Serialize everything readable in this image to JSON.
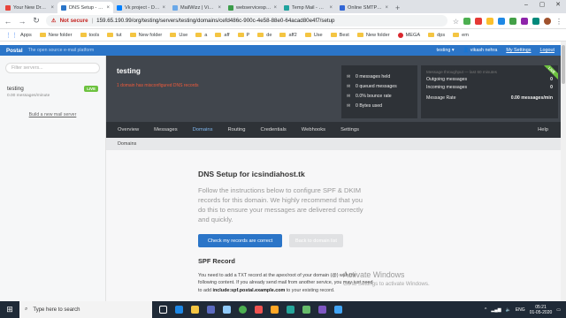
{
  "browser": {
    "tabs": [
      {
        "title": "Your New Droplet",
        "color": "#e8453c",
        "active": false
      },
      {
        "title": "DNS Setup - icsin",
        "color": "#2b75c8",
        "active": true
      },
      {
        "title": "Vk project - Digit",
        "color": "#0080ff",
        "active": false
      },
      {
        "title": "MailWizz | View d",
        "color": "#6aa8e8",
        "active": false
      },
      {
        "title": "webservicespot |",
        "color": "#3b9c4a",
        "active": false
      },
      {
        "title": "Temp Mail - Disp",
        "color": "#20a39e",
        "active": false
      },
      {
        "title": "Online SMTP tool",
        "color": "#3367d6",
        "active": false
      }
    ],
    "not_secure": "Not secure",
    "url": "159.65.190.99/org/testing/servers/testing/domains/cefd486c-900c-4e58-88e0-64acad80e4f7/setup",
    "bookmarks": [
      "Apps",
      "New folder",
      "tools",
      "tut",
      "New folder",
      "Use",
      "a",
      "aff",
      "P",
      "de",
      "aff2",
      "Use",
      "Best",
      "New folder",
      "MEGA",
      "dps",
      "em"
    ]
  },
  "postal": {
    "logo": "Postal",
    "tagline": "The open source e-mail platform",
    "org": "testing ▾",
    "user": "👤 vikash nehra",
    "settings": "My Settings",
    "logout": "Logout"
  },
  "sidebar": {
    "filter_placeholder": "Filter servers...",
    "server_name": "testing",
    "live_badge": "LIVE",
    "rate": "0.00 messages/minute",
    "build_link": "Build a new mail server"
  },
  "server": {
    "title": "testing",
    "warning": "1 domain has misconfigured DNS records",
    "stats": [
      {
        "icon": "✉",
        "text": "0 messages held"
      },
      {
        "icon": "✉",
        "text": "0 queued messages"
      },
      {
        "icon": "✉",
        "text": "0.0% bounce rate"
      },
      {
        "icon": "✉",
        "text": "0 Bytes used"
      }
    ],
    "throughput_title": "Message throughput — last 60 minutes",
    "outgoing_label": "Outgoing messages",
    "outgoing_value": "0",
    "incoming_label": "Incoming messages",
    "incoming_value": "0",
    "rate_label": "Message Rate",
    "rate_value": "0.00 messages/min",
    "ribbon": "LIVE"
  },
  "nav": {
    "items": [
      "Overview",
      "Messages",
      "Domains",
      "Routing",
      "Credentials",
      "Webhooks",
      "Settings"
    ],
    "active": "Domains",
    "help": "Help",
    "subnav": "Domains"
  },
  "content": {
    "title": "DNS Setup for icsindiahost.tk",
    "lead": "Follow the instructions below to configure SPF & DKIM records for this domain. We highly recommend that you do this to ensure your messages are delivered correctly and quickly.",
    "check_button": "Check my records are correct",
    "back_button": "Back to domain list",
    "spf_heading": "SPF Record",
    "spf_text_1": "You need to add a TXT record at the apex/root of your domain (@) with the following content. If you already send mail from another service, you may just need to add",
    "spf_include": "include:spf.postal.example.com",
    "spf_text_2": "to your existing record."
  },
  "watermark": {
    "line1": "Activate Windows",
    "line2": "Go to Settings to activate Windows."
  },
  "taskbar": {
    "search_placeholder": "Type here to search",
    "lang": "ENG",
    "time": "05:21",
    "date": "01-05-2020"
  }
}
